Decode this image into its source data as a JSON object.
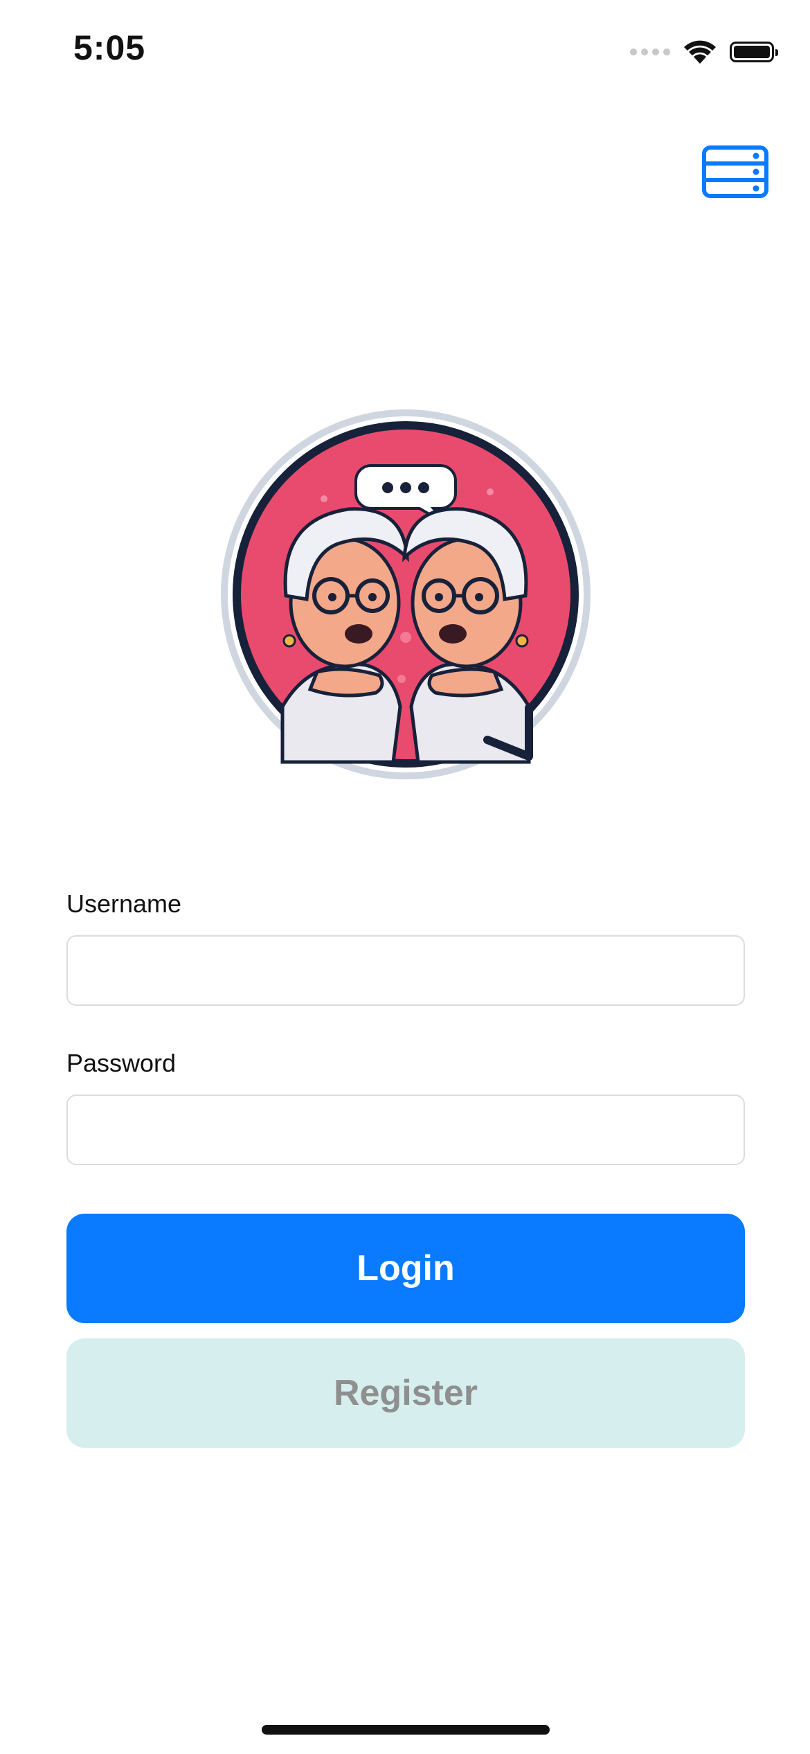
{
  "status_bar": {
    "time": "5:05"
  },
  "form": {
    "username": {
      "label": "Username",
      "value": "",
      "placeholder": ""
    },
    "password": {
      "label": "Password",
      "value": "",
      "placeholder": ""
    }
  },
  "buttons": {
    "login_label": "Login",
    "register_label": "Register"
  },
  "icons": {
    "server": "server-icon",
    "logo": "app-logo"
  },
  "colors": {
    "accent": "#0a7aff",
    "register_bg": "#d6efee",
    "register_text": "#8f8f8f",
    "logo_bg": "#e94b6e"
  }
}
